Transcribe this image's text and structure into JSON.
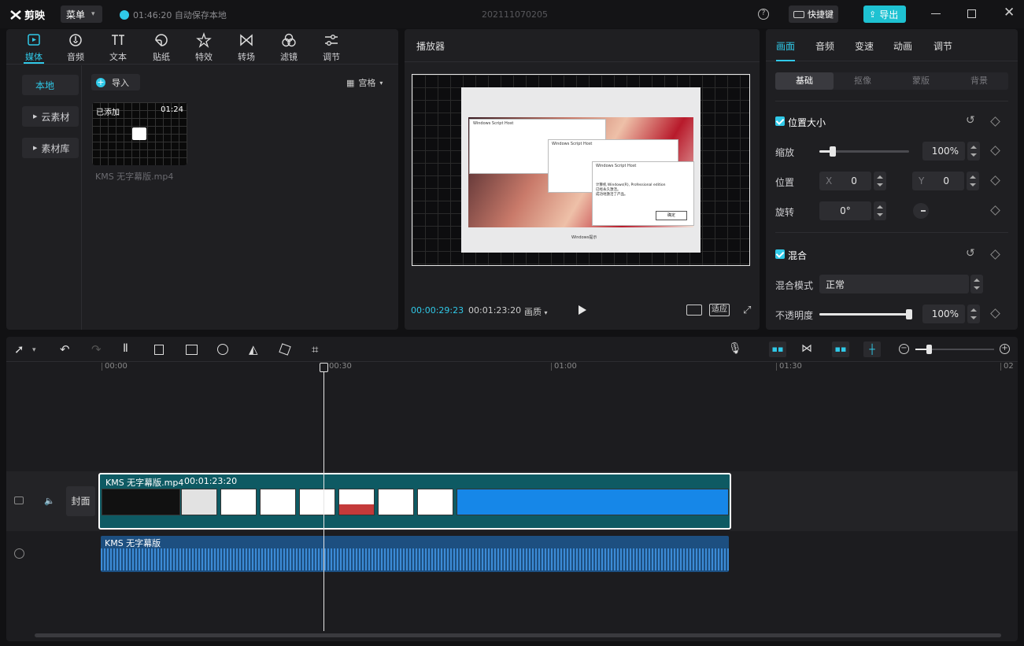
{
  "app": {
    "name": "剪映",
    "menu_label": "菜单",
    "autosave": "01:46:20 自动保存本地",
    "project_title": "202111070205",
    "shortcut_label": "快捷键",
    "export_label": "导出"
  },
  "toolbar": {
    "items": [
      {
        "label": "媒体",
        "icon": "media-icon",
        "active": true
      },
      {
        "label": "音频",
        "icon": "audio-icon"
      },
      {
        "label": "文本",
        "icon": "text-icon"
      },
      {
        "label": "贴纸",
        "icon": "sticker-icon"
      },
      {
        "label": "特效",
        "icon": "effects-icon"
      },
      {
        "label": "转场",
        "icon": "transition-icon"
      },
      {
        "label": "滤镜",
        "icon": "filter-icon"
      },
      {
        "label": "调节",
        "icon": "adjust-icon"
      }
    ]
  },
  "media": {
    "side": [
      "本地",
      "云素材",
      "素材库"
    ],
    "import_label": "导入",
    "view_label": "宫格",
    "clip": {
      "badge": "已添加",
      "duration": "01:24",
      "name": "KMS 无字幕版.mp4"
    }
  },
  "player": {
    "title": "播放器",
    "current": "00:00:29:23",
    "total": "00:01:23:20",
    "quality": "画质",
    "fit": "适应",
    "preview": {
      "win1_title": "Windows Script Host",
      "win2_title": "Windows Script Host",
      "win3_title": "Windows Script Host",
      "win3_text": "计算机 Windows(R), Professional edition\n已经永久激活。\n成功地激活了产品。",
      "ok": "确定",
      "caption": "Windows提示"
    }
  },
  "inspector": {
    "tabs": [
      "画面",
      "音频",
      "变速",
      "动画",
      "调节"
    ],
    "subtabs": [
      "基础",
      "抠像",
      "蒙版",
      "背景"
    ],
    "section1": "位置大小",
    "scale_label": "缩放",
    "scale_value": "100%",
    "scale_fraction": 0.15,
    "position_label": "位置",
    "x_label": "X",
    "x_value": "0",
    "y_label": "Y",
    "y_value": "0",
    "rotate_label": "旋转",
    "rotate_value": "0°",
    "section2": "混合",
    "blend_label": "混合模式",
    "blend_value": "正常",
    "opacity_label": "不透明度",
    "opacity_value": "100%",
    "opacity_fraction": 1.0
  },
  "timeline": {
    "ruler": [
      "00:00",
      "00:30",
      "01:00",
      "01:30",
      "02"
    ],
    "cover_label": "封面",
    "video_clip": {
      "name": "KMS 无字幕版.mp4",
      "duration": "00:01:23:20"
    },
    "audio_clip": {
      "name": "KMS 无字幕版"
    }
  },
  "colors": {
    "accent": "#30c9e8",
    "clip": "#0e5a63",
    "audio": "#1d4f80"
  }
}
